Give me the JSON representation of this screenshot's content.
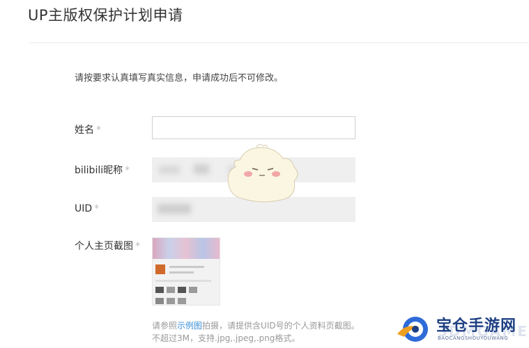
{
  "page_title": "UP主版权保护计划申请",
  "notice": "请按要求认真填写真实信息，申请成功后不可修改。",
  "required_mark": "*",
  "form": {
    "name_label": "姓名",
    "nickname_label": "bilibili昵称",
    "uid_label": "UID",
    "screenshot_label": "个人主页截图"
  },
  "help": {
    "prefix": "请参照",
    "link": "示例图",
    "middle": "拍摄，请提供含UID号的个人资料页截图。",
    "line2": "不超过3M，支持.jpg,.jpeg,.png格式。"
  },
  "watermark": {
    "name": "宝仓手游网",
    "subtitle": "BAOCANGSHOUYOUWANG",
    "ghost": "3DMGAME"
  },
  "colors": {
    "link": "#3a8fd6",
    "border": "#cfcfcf",
    "watermark_blue": "#1d3f82"
  }
}
